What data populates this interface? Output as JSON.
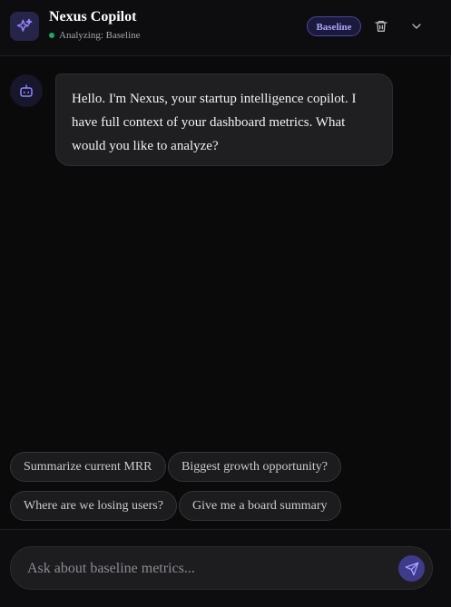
{
  "header": {
    "title": "Nexus Copilot",
    "status": "Analyzing: Baseline",
    "badge": "Baseline",
    "brand_icon": "sparkles-icon",
    "delete_icon": "trash-icon",
    "collapse_icon": "chevron-down-icon"
  },
  "messages": [
    {
      "role": "assistant",
      "avatar_icon": "bot-icon",
      "text": "Hello. I'm Nexus, your startup intelligence copilot. I have full context of your dashboard metrics. What would you like to analyze?"
    }
  ],
  "suggestions": [
    "Summarize current MRR",
    "Biggest growth opportunity?",
    "Where are we losing users?",
    "Give me a board summary"
  ],
  "composer": {
    "placeholder": "Ask about baseline metrics...",
    "value": "",
    "send_icon": "send-icon"
  },
  "colors": {
    "accent": "#6c63ff",
    "status_online": "#1fa36a",
    "background": "#0a0a0b"
  }
}
